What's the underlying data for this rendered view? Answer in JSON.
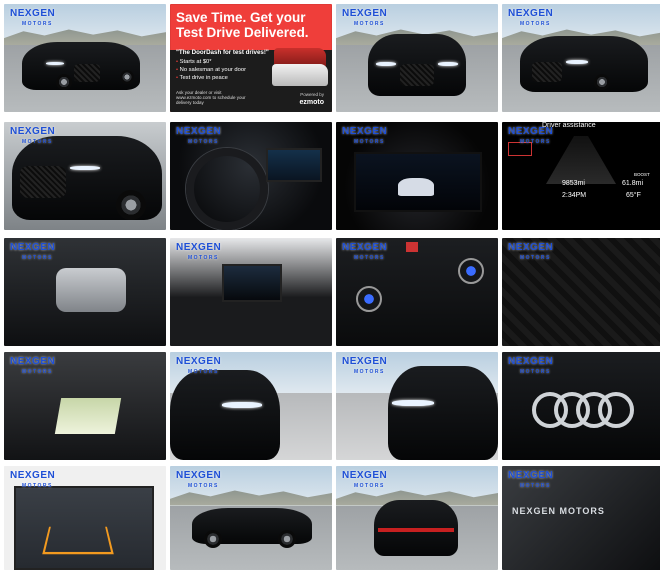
{
  "dealer_logo": {
    "name": "NEXGEN",
    "sub": "MOTORS"
  },
  "ad": {
    "headline": "Save Time. Get your Test Drive Delivered.",
    "quote": "\"The DoorDash for test drives!\"",
    "bullets": [
      "Starts at $0*",
      "No salesman at your door",
      "Test drive in peace"
    ],
    "small_text": "Ask your dealer or visit www.ezmoto.com to schedule your delivery today",
    "powered_by": "Powered by",
    "brand": "ezmoto"
  },
  "dashboard": {
    "mode": "Driver assistance",
    "range": "9853mi",
    "time": "2:34PM",
    "trip": "61.8mi",
    "temp": "65°F",
    "boost_label": "BOOST"
  },
  "photos": [
    {
      "label": "front-three-quarter"
    },
    {
      "label": "ad"
    },
    {
      "label": "front-view"
    },
    {
      "label": "front-three-quarter-right"
    },
    {
      "label": "front-closeup"
    },
    {
      "label": "steering-wheel"
    },
    {
      "label": "instrument-cluster"
    },
    {
      "label": "virtual-cockpit"
    },
    {
      "label": "engine-bay"
    },
    {
      "label": "infotainment-screen"
    },
    {
      "label": "climate-controls"
    },
    {
      "label": "seat-detail"
    },
    {
      "label": "sunroof"
    },
    {
      "label": "headlight-left"
    },
    {
      "label": "headlight-right"
    },
    {
      "label": "grille-rings"
    },
    {
      "label": "backup-camera"
    },
    {
      "label": "side-profile"
    },
    {
      "label": "rear-view"
    },
    {
      "label": "dealer-glass-badge"
    }
  ]
}
